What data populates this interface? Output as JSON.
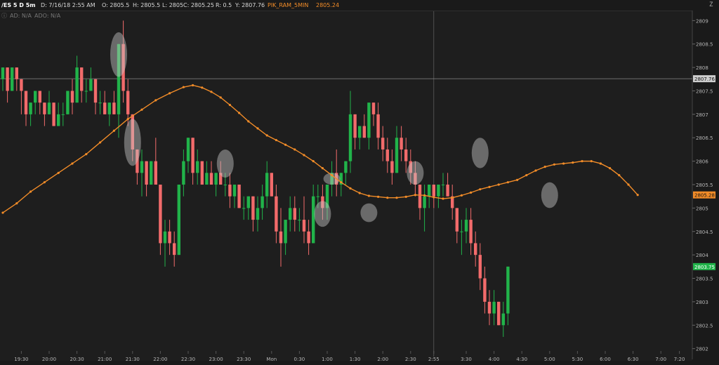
{
  "header": {
    "symbol": "/ES 5 D 5m",
    "date": "D: 7/16/18 2:55 AM",
    "open": "O: 2805.5",
    "high": "H: 2805.5",
    "low": "L: 2805",
    "close": "C: 2805.25",
    "range": "R: 0.5",
    "y": "Y: 2807.76",
    "study_name": "PIK_RAM_5MIN",
    "study_value": "2805.24"
  },
  "sub_labels": [
    "AD: N/A",
    "ADO: N/A"
  ],
  "colors": {
    "background": "#1e1e1e",
    "up": "#21b34a",
    "down": "#f26b6b",
    "ma": "#f28c28",
    "grid": "#3a3a3a",
    "axis_text": "#b4b4b4"
  },
  "chart_data": {
    "type": "candlestick",
    "y_range": [
      2802.0,
      2809.2
    ],
    "y_ticks": [
      "2809",
      "2808.5",
      "2808",
      "2807.5",
      "2807",
      "2806.5",
      "2806",
      "2805.5",
      "2805",
      "2804.5",
      "2804",
      "2803.5",
      "2803",
      "2802.5",
      "2802"
    ],
    "y_tick_values": [
      2809,
      2808.5,
      2808,
      2807.5,
      2807,
      2806.5,
      2806,
      2805.5,
      2805,
      2804.5,
      2804,
      2803.5,
      2803,
      2802.5,
      2802
    ],
    "x_ticks": [
      "19:30",
      "20:00",
      "20:30",
      "21:00",
      "21:30",
      "22:00",
      "22:30",
      "23:00",
      "23:30",
      "Mon",
      "0:30",
      "1:00",
      "1:30",
      "2:00",
      "2:30",
      "2:55",
      "3:30",
      "4:00",
      "4:30",
      "5:00",
      "5:30",
      "6:00",
      "6:30",
      "7:00",
      "7:20"
    ],
    "x_tick_index": [
      4,
      10,
      16,
      22,
      28,
      34,
      40,
      46,
      52,
      58,
      64,
      70,
      76,
      82,
      88,
      93,
      100,
      106,
      112,
      118,
      124,
      130,
      136,
      142,
      146
    ],
    "price_labels": [
      {
        "label": "2807.76",
        "value": 2807.76,
        "kind": "crosshair"
      },
      {
        "label": "2805.28",
        "value": 2805.28,
        "kind": "ma"
      },
      {
        "label": "2803.75",
        "value": 2803.75,
        "kind": "last"
      }
    ],
    "crosshair": {
      "index": 93,
      "value": 2807.76
    },
    "candles": [
      {
        "o": 2807.75,
        "h": 2808.0,
        "l": 2807.5,
        "c": 2808.0
      },
      {
        "o": 2808.0,
        "h": 2808.0,
        "l": 2807.25,
        "c": 2807.5
      },
      {
        "o": 2807.5,
        "h": 2808.0,
        "l": 2807.5,
        "c": 2808.0
      },
      {
        "o": 2808.0,
        "h": 2808.0,
        "l": 2807.5,
        "c": 2807.75
      },
      {
        "o": 2807.75,
        "h": 2807.75,
        "l": 2807.0,
        "c": 2807.5
      },
      {
        "o": 2807.5,
        "h": 2807.5,
        "l": 2806.75,
        "c": 2807.0
      },
      {
        "o": 2807.0,
        "h": 2807.25,
        "l": 2806.75,
        "c": 2807.25
      },
      {
        "o": 2807.25,
        "h": 2807.5,
        "l": 2807.0,
        "c": 2807.5
      },
      {
        "o": 2807.5,
        "h": 2807.5,
        "l": 2807.0,
        "c": 2807.25
      },
      {
        "o": 2807.25,
        "h": 2807.25,
        "l": 2806.75,
        "c": 2807.0
      },
      {
        "o": 2807.0,
        "h": 2807.5,
        "l": 2807.0,
        "c": 2807.25
      },
      {
        "o": 2807.25,
        "h": 2807.25,
        "l": 2806.75,
        "c": 2806.75
      },
      {
        "o": 2806.75,
        "h": 2807.25,
        "l": 2806.75,
        "c": 2807.0
      },
      {
        "o": 2807.0,
        "h": 2807.25,
        "l": 2806.75,
        "c": 2807.0
      },
      {
        "o": 2807.0,
        "h": 2807.5,
        "l": 2807.0,
        "c": 2807.5
      },
      {
        "o": 2807.5,
        "h": 2807.75,
        "l": 2807.0,
        "c": 2807.25
      },
      {
        "o": 2807.25,
        "h": 2808.25,
        "l": 2807.25,
        "c": 2808.0
      },
      {
        "o": 2808.0,
        "h": 2808.0,
        "l": 2807.25,
        "c": 2807.5
      },
      {
        "o": 2807.5,
        "h": 2807.75,
        "l": 2807.25,
        "c": 2807.5
      },
      {
        "o": 2807.5,
        "h": 2808.0,
        "l": 2807.5,
        "c": 2807.75
      },
      {
        "o": 2807.75,
        "h": 2807.75,
        "l": 2807.0,
        "c": 2807.25
      },
      {
        "o": 2807.25,
        "h": 2807.5,
        "l": 2807.0,
        "c": 2807.25
      },
      {
        "o": 2807.25,
        "h": 2807.5,
        "l": 2807.0,
        "c": 2807.0
      },
      {
        "o": 2807.0,
        "h": 2807.25,
        "l": 2806.75,
        "c": 2807.25
      },
      {
        "o": 2807.25,
        "h": 2807.5,
        "l": 2807.0,
        "c": 2807.0
      },
      {
        "o": 2807.0,
        "h": 2808.5,
        "l": 2806.5,
        "c": 2808.5
      },
      {
        "o": 2808.5,
        "h": 2809.0,
        "l": 2807.25,
        "c": 2807.5
      },
      {
        "o": 2807.5,
        "h": 2807.75,
        "l": 2806.75,
        "c": 2807.0
      },
      {
        "o": 2807.0,
        "h": 2806.5,
        "l": 2806.0,
        "c": 2806.25
      },
      {
        "o": 2806.25,
        "h": 2806.25,
        "l": 2805.5,
        "c": 2805.75
      },
      {
        "o": 2805.75,
        "h": 2806.25,
        "l": 2805.25,
        "c": 2806.0
      },
      {
        "o": 2806.0,
        "h": 2806.0,
        "l": 2805.25,
        "c": 2805.5
      },
      {
        "o": 2805.5,
        "h": 2806.0,
        "l": 2805.5,
        "c": 2806.0
      },
      {
        "o": 2806.0,
        "h": 2806.5,
        "l": 2805.5,
        "c": 2805.5
      },
      {
        "o": 2805.5,
        "h": 2805.5,
        "l": 2804.0,
        "c": 2804.25
      },
      {
        "o": 2804.25,
        "h": 2804.75,
        "l": 2803.75,
        "c": 2804.5
      },
      {
        "o": 2804.5,
        "h": 2804.75,
        "l": 2804.0,
        "c": 2804.25
      },
      {
        "o": 2804.25,
        "h": 2804.5,
        "l": 2803.75,
        "c": 2804.0
      },
      {
        "o": 2804.0,
        "h": 2805.5,
        "l": 2804.0,
        "c": 2805.5
      },
      {
        "o": 2805.5,
        "h": 2806.25,
        "l": 2805.25,
        "c": 2806.0
      },
      {
        "o": 2806.0,
        "h": 2806.5,
        "l": 2805.75,
        "c": 2806.5
      },
      {
        "o": 2806.5,
        "h": 2806.5,
        "l": 2805.5,
        "c": 2805.75
      },
      {
        "o": 2805.75,
        "h": 2806.25,
        "l": 2805.5,
        "c": 2806.0
      },
      {
        "o": 2806.0,
        "h": 2806.0,
        "l": 2805.5,
        "c": 2805.5
      },
      {
        "o": 2805.5,
        "h": 2806.0,
        "l": 2805.5,
        "c": 2805.75
      },
      {
        "o": 2805.75,
        "h": 2806.0,
        "l": 2805.5,
        "c": 2805.5
      },
      {
        "o": 2805.5,
        "h": 2805.75,
        "l": 2805.25,
        "c": 2805.75
      },
      {
        "o": 2805.75,
        "h": 2806.0,
        "l": 2805.5,
        "c": 2805.5
      },
      {
        "o": 2805.5,
        "h": 2805.75,
        "l": 2805.25,
        "c": 2805.5
      },
      {
        "o": 2805.5,
        "h": 2805.75,
        "l": 2805.0,
        "c": 2805.25
      },
      {
        "o": 2805.25,
        "h": 2805.5,
        "l": 2805.0,
        "c": 2805.5
      },
      {
        "o": 2805.5,
        "h": 2805.5,
        "l": 2805.0,
        "c": 2805.0
      },
      {
        "o": 2805.0,
        "h": 2805.25,
        "l": 2804.75,
        "c": 2805.0
      },
      {
        "o": 2805.0,
        "h": 2805.25,
        "l": 2804.75,
        "c": 2805.25
      },
      {
        "o": 2805.25,
        "h": 2805.25,
        "l": 2804.5,
        "c": 2804.75
      },
      {
        "o": 2804.75,
        "h": 2805.25,
        "l": 2804.5,
        "c": 2805.0
      },
      {
        "o": 2805.0,
        "h": 2805.5,
        "l": 2804.75,
        "c": 2805.25
      },
      {
        "o": 2805.25,
        "h": 2806.0,
        "l": 2805.0,
        "c": 2805.75
      },
      {
        "o": 2805.75,
        "h": 2805.75,
        "l": 2805.25,
        "c": 2805.25
      },
      {
        "o": 2805.25,
        "h": 2805.5,
        "l": 2804.25,
        "c": 2804.5
      },
      {
        "o": 2804.5,
        "h": 2805.0,
        "l": 2803.75,
        "c": 2804.25
      },
      {
        "o": 2804.25,
        "h": 2804.75,
        "l": 2804.0,
        "c": 2804.75
      },
      {
        "o": 2804.75,
        "h": 2805.25,
        "l": 2804.5,
        "c": 2805.0
      },
      {
        "o": 2805.0,
        "h": 2805.25,
        "l": 2804.5,
        "c": 2804.75
      },
      {
        "o": 2804.75,
        "h": 2805.0,
        "l": 2804.5,
        "c": 2804.75
      },
      {
        "o": 2804.75,
        "h": 2805.25,
        "l": 2804.25,
        "c": 2804.5
      },
      {
        "o": 2804.5,
        "h": 2804.75,
        "l": 2804.0,
        "c": 2804.25
      },
      {
        "o": 2804.25,
        "h": 2805.5,
        "l": 2804.25,
        "c": 2805.25
      },
      {
        "o": 2805.25,
        "h": 2805.5,
        "l": 2805.0,
        "c": 2805.25
      },
      {
        "o": 2805.25,
        "h": 2805.5,
        "l": 2804.75,
        "c": 2805.0
      },
      {
        "o": 2805.0,
        "h": 2805.5,
        "l": 2804.75,
        "c": 2805.5
      },
      {
        "o": 2805.5,
        "h": 2806.0,
        "l": 2805.25,
        "c": 2805.75
      },
      {
        "o": 2805.75,
        "h": 2806.25,
        "l": 2805.25,
        "c": 2805.5
      },
      {
        "o": 2805.5,
        "h": 2805.75,
        "l": 2805.25,
        "c": 2805.75
      },
      {
        "o": 2805.75,
        "h": 2806.0,
        "l": 2805.5,
        "c": 2806.0
      },
      {
        "o": 2806.0,
        "h": 2807.5,
        "l": 2805.75,
        "c": 2807.0
      },
      {
        "o": 2807.0,
        "h": 2807.0,
        "l": 2806.25,
        "c": 2806.5
      },
      {
        "o": 2806.5,
        "h": 2806.75,
        "l": 2806.25,
        "c": 2806.75
      },
      {
        "o": 2806.75,
        "h": 2807.0,
        "l": 2806.5,
        "c": 2806.5
      },
      {
        "o": 2806.5,
        "h": 2807.25,
        "l": 2806.25,
        "c": 2807.25
      },
      {
        "o": 2807.25,
        "h": 2807.25,
        "l": 2806.75,
        "c": 2807.0
      },
      {
        "o": 2807.0,
        "h": 2807.25,
        "l": 2806.25,
        "c": 2806.5
      },
      {
        "o": 2806.5,
        "h": 2806.75,
        "l": 2806.0,
        "c": 2806.25
      },
      {
        "o": 2806.25,
        "h": 2806.5,
        "l": 2805.75,
        "c": 2806.0
      },
      {
        "o": 2806.0,
        "h": 2806.25,
        "l": 2805.5,
        "c": 2805.75
      },
      {
        "o": 2805.75,
        "h": 2806.75,
        "l": 2805.75,
        "c": 2806.5
      },
      {
        "o": 2806.5,
        "h": 2806.75,
        "l": 2806.0,
        "c": 2806.25
      },
      {
        "o": 2806.25,
        "h": 2806.5,
        "l": 2805.75,
        "c": 2806.0
      },
      {
        "o": 2806.0,
        "h": 2806.25,
        "l": 2805.5,
        "c": 2805.75
      },
      {
        "o": 2805.75,
        "h": 2806.0,
        "l": 2805.25,
        "c": 2805.5
      },
      {
        "o": 2805.5,
        "h": 2805.5,
        "l": 2804.75,
        "c": 2805.0
      },
      {
        "o": 2805.0,
        "h": 2805.5,
        "l": 2804.5,
        "c": 2805.25
      },
      {
        "o": 2805.25,
        "h": 2805.5,
        "l": 2805.0,
        "c": 2805.5
      },
      {
        "o": 2805.5,
        "h": 2805.5,
        "l": 2805.0,
        "c": 2805.25
      },
      {
        "o": 2805.25,
        "h": 2805.5,
        "l": 2805.0,
        "c": 2805.5
      },
      {
        "o": 2805.5,
        "h": 2805.75,
        "l": 2805.25,
        "c": 2805.5
      },
      {
        "o": 2805.5,
        "h": 2805.75,
        "l": 2805.25,
        "c": 2805.25
      },
      {
        "o": 2805.25,
        "h": 2805.5,
        "l": 2804.75,
        "c": 2805.0
      },
      {
        "o": 2805.0,
        "h": 2805.0,
        "l": 2804.25,
        "c": 2804.5
      },
      {
        "o": 2804.5,
        "h": 2804.75,
        "l": 2804.0,
        "c": 2804.5
      },
      {
        "o": 2804.5,
        "h": 2805.0,
        "l": 2804.25,
        "c": 2804.75
      },
      {
        "o": 2804.75,
        "h": 2805.0,
        "l": 2804.0,
        "c": 2804.25
      },
      {
        "o": 2804.25,
        "h": 2804.5,
        "l": 2803.75,
        "c": 2804.0
      },
      {
        "o": 2804.0,
        "h": 2804.25,
        "l": 2803.25,
        "c": 2803.5
      },
      {
        "o": 2803.5,
        "h": 2803.75,
        "l": 2802.75,
        "c": 2803.0
      },
      {
        "o": 2803.0,
        "h": 2803.25,
        "l": 2802.5,
        "c": 2802.75
      },
      {
        "o": 2802.75,
        "h": 2803.25,
        "l": 2802.5,
        "c": 2803.0
      },
      {
        "o": 2803.0,
        "h": 2803.0,
        "l": 2802.5,
        "c": 2802.5
      },
      {
        "o": 2802.5,
        "h": 2803.0,
        "l": 2802.25,
        "c": 2802.75
      },
      {
        "o": 2802.75,
        "h": 2803.75,
        "l": 2802.5,
        "c": 2803.75
      }
    ],
    "ma": [
      {
        "i": 0,
        "v": 2804.9
      },
      {
        "i": 3,
        "v": 2805.1
      },
      {
        "i": 6,
        "v": 2805.35
      },
      {
        "i": 9,
        "v": 2805.55
      },
      {
        "i": 12,
        "v": 2805.75
      },
      {
        "i": 15,
        "v": 2805.95
      },
      {
        "i": 18,
        "v": 2806.15
      },
      {
        "i": 21,
        "v": 2806.4
      },
      {
        "i": 24,
        "v": 2806.65
      },
      {
        "i": 27,
        "v": 2806.9
      },
      {
        "i": 30,
        "v": 2807.1
      },
      {
        "i": 33,
        "v": 2807.3
      },
      {
        "i": 36,
        "v": 2807.45
      },
      {
        "i": 39,
        "v": 2807.58
      },
      {
        "i": 41,
        "v": 2807.62
      },
      {
        "i": 43,
        "v": 2807.57
      },
      {
        "i": 45,
        "v": 2807.48
      },
      {
        "i": 47,
        "v": 2807.36
      },
      {
        "i": 49,
        "v": 2807.2
      },
      {
        "i": 51,
        "v": 2807.03
      },
      {
        "i": 53,
        "v": 2806.85
      },
      {
        "i": 55,
        "v": 2806.7
      },
      {
        "i": 57,
        "v": 2806.55
      },
      {
        "i": 59,
        "v": 2806.45
      },
      {
        "i": 61,
        "v": 2806.35
      },
      {
        "i": 63,
        "v": 2806.25
      },
      {
        "i": 65,
        "v": 2806.13
      },
      {
        "i": 67,
        "v": 2806.0
      },
      {
        "i": 69,
        "v": 2805.85
      },
      {
        "i": 71,
        "v": 2805.7
      },
      {
        "i": 73,
        "v": 2805.55
      },
      {
        "i": 75,
        "v": 2805.42
      },
      {
        "i": 77,
        "v": 2805.32
      },
      {
        "i": 79,
        "v": 2805.26
      },
      {
        "i": 81,
        "v": 2805.24
      },
      {
        "i": 83,
        "v": 2805.22
      },
      {
        "i": 85,
        "v": 2805.22
      },
      {
        "i": 87,
        "v": 2805.24
      },
      {
        "i": 89,
        "v": 2805.28
      },
      {
        "i": 91,
        "v": 2805.27
      },
      {
        "i": 93,
        "v": 2805.23
      },
      {
        "i": 95,
        "v": 2805.2
      },
      {
        "i": 97,
        "v": 2805.22
      },
      {
        "i": 99,
        "v": 2805.27
      },
      {
        "i": 101,
        "v": 2805.33
      },
      {
        "i": 103,
        "v": 2805.4
      },
      {
        "i": 105,
        "v": 2805.45
      },
      {
        "i": 107,
        "v": 2805.5
      },
      {
        "i": 109,
        "v": 2805.55
      },
      {
        "i": 111,
        "v": 2805.6
      },
      {
        "i": 113,
        "v": 2805.7
      },
      {
        "i": 115,
        "v": 2805.8
      },
      {
        "i": 117,
        "v": 2805.88
      },
      {
        "i": 119,
        "v": 2805.93
      },
      {
        "i": 121,
        "v": 2805.95
      },
      {
        "i": 123,
        "v": 2805.97
      },
      {
        "i": 125,
        "v": 2806.0
      },
      {
        "i": 127,
        "v": 2806.0
      },
      {
        "i": 129,
        "v": 2805.95
      },
      {
        "i": 131,
        "v": 2805.85
      },
      {
        "i": 133,
        "v": 2805.7
      },
      {
        "i": 135,
        "v": 2805.5
      },
      {
        "i": 137,
        "v": 2805.28
      }
    ],
    "highlights": [
      {
        "i": 25,
        "top": 2808.75,
        "bottom": 2807.8
      },
      {
        "i": 28,
        "top": 2806.9,
        "bottom": 2805.9
      },
      {
        "i": 48,
        "top": 2806.25,
        "bottom": 2805.65
      },
      {
        "i": 71,
        "top": 2805.75,
        "bottom": 2805.5
      },
      {
        "i": 69,
        "top": 2805.15,
        "bottom": 2804.6
      },
      {
        "i": 79,
        "top": 2805.1,
        "bottom": 2804.7
      },
      {
        "i": 89,
        "top": 2806.0,
        "bottom": 2805.5
      },
      {
        "i": 103,
        "top": 2806.5,
        "bottom": 2805.85
      },
      {
        "i": 118,
        "top": 2805.55,
        "bottom": 2805.0
      }
    ]
  }
}
